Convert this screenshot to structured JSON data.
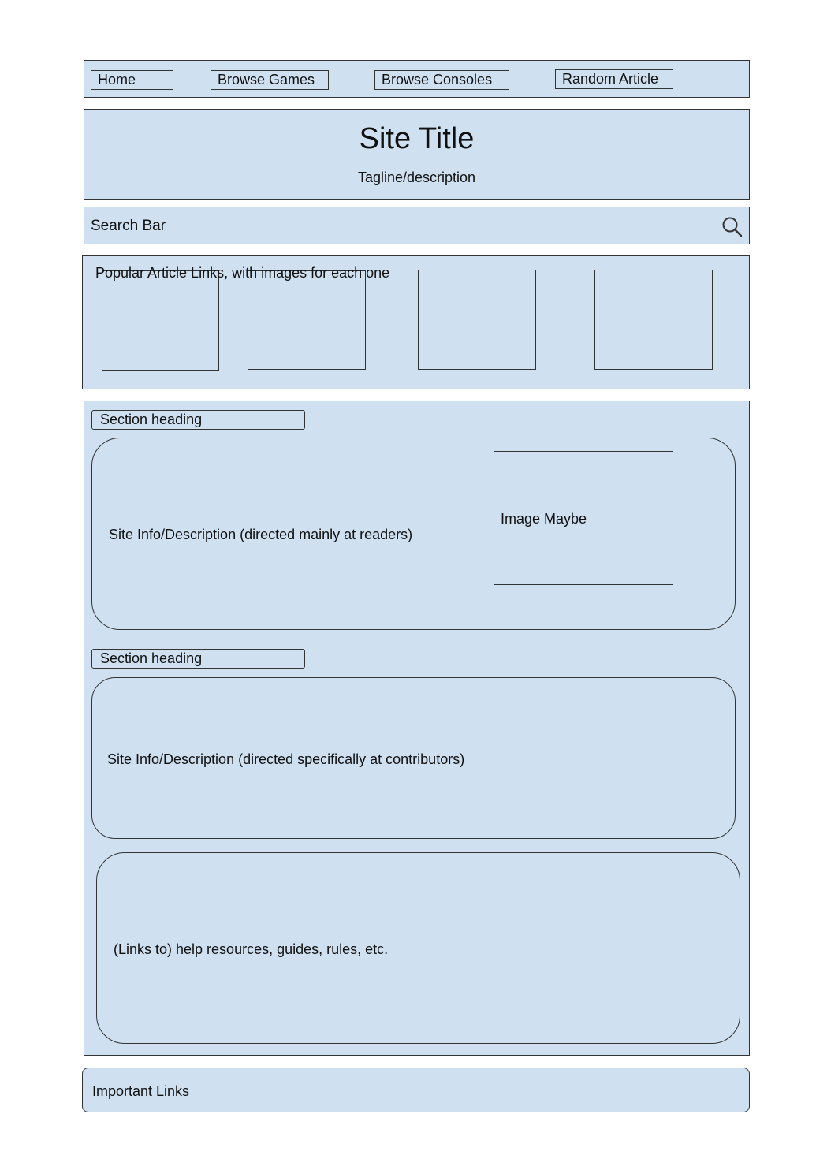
{
  "nav": {
    "items": [
      {
        "label": "Home"
      },
      {
        "label": "Browse Games"
      },
      {
        "label": "Browse Consoles"
      },
      {
        "label": "Random Article"
      }
    ]
  },
  "header": {
    "title": "Site Title",
    "tagline": "Tagline/description"
  },
  "search": {
    "placeholder": "Search Bar",
    "icon": "search-icon"
  },
  "popular": {
    "label": "Popular Article Links, with images for each one",
    "thumbnail_count": 4
  },
  "main": {
    "section_1": {
      "heading": "Section heading",
      "description": "Site Info/Description (directed mainly at readers)",
      "image_label": "Image Maybe"
    },
    "section_2": {
      "heading": "Section heading",
      "description": "Site Info/Description (directed specifically at contributors)"
    },
    "help": {
      "text": "(Links to) help resources, guides, rules, etc."
    }
  },
  "footer": {
    "label": "Important Links"
  },
  "colors": {
    "box_fill": "#cfe0f1",
    "border": "#333333",
    "text": "#111111"
  }
}
